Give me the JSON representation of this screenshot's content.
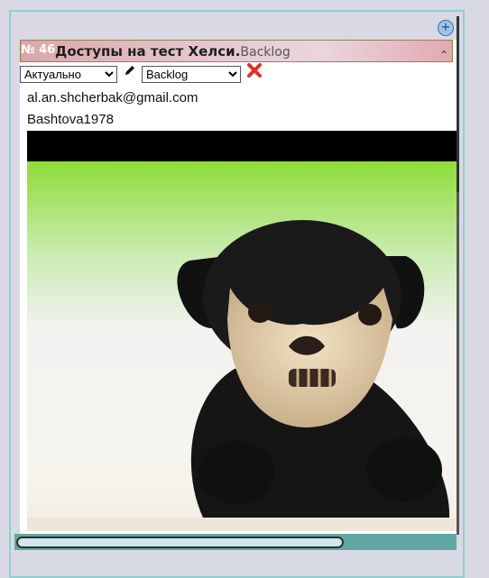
{
  "card": {
    "number": "№ 46",
    "title": "Доступы на тест Хелси.",
    "status_label": "Backlog",
    "add_symbol": "+",
    "collapse_symbol": "⌃"
  },
  "controls": {
    "relevance_select": {
      "value": "Актуально",
      "options": [
        "Актуально"
      ]
    },
    "stage_select": {
      "value": "Backlog",
      "options": [
        "Backlog"
      ]
    },
    "edit_icon": "pencil-icon",
    "delete_icon": "close-icon"
  },
  "content": {
    "line1": "al.an.shcherbak@gmail.com",
    "line2": "Bashtova1978"
  },
  "colors": {
    "header_gradient_start": "#d9a7a7",
    "header_gradient_end": "#e2a9b0",
    "frame_border": "#8fd0d0",
    "scrollbar": "#5ea7a3",
    "delete_red": "#e0302a"
  }
}
